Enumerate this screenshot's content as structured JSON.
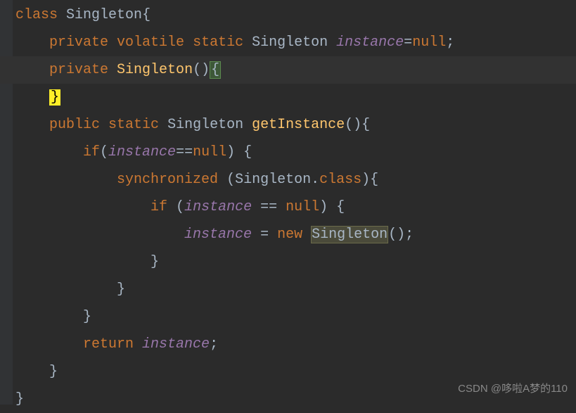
{
  "code": {
    "line1": {
      "kw_class": "class",
      "type": "Singleton",
      "brace": "{"
    },
    "line2": {
      "kw_private": "private",
      "kw_volatile": "volatile",
      "kw_static": "static",
      "type": "Singleton",
      "field": "instance",
      "op": "=",
      "kw_null": "null",
      "semi": ";"
    },
    "line3": {
      "kw_private": "private",
      "ctor": "Singleton",
      "parens": "()",
      "brace": "{"
    },
    "line4": {
      "brace": "}"
    },
    "line5": {
      "kw_public": "public",
      "kw_static": "static",
      "type": "Singleton",
      "method": "getInstance",
      "parens": "()",
      "brace": "{"
    },
    "line6": {
      "kw_if": "if",
      "lparen": "(",
      "field": "instance",
      "op": "==",
      "kw_null": "null",
      "rparen": ")",
      "brace": " {"
    },
    "line7": {
      "kw_sync": "synchronized",
      "lparen": " (",
      "type": "Singleton",
      "dot": ".",
      "kw_class": "class",
      "rparen": ")",
      "brace": "{"
    },
    "line8": {
      "kw_if": "if",
      "lparen": " (",
      "field": "instance",
      "op": " == ",
      "kw_null": "null",
      "rparen": ")",
      "brace": " {"
    },
    "line9": {
      "field": "instance",
      "op": " = ",
      "kw_new": "new",
      "ctor": "Singleton",
      "parens": "()",
      "semi": ";"
    },
    "line10": {
      "brace": "}"
    },
    "line11": {
      "brace": "}"
    },
    "line12": {
      "brace": "}"
    },
    "line13": {
      "kw_return": "return",
      "field": "instance",
      "semi": ";"
    },
    "line14": {
      "brace": "}"
    },
    "line15": {
      "brace": "}"
    }
  },
  "watermark": "CSDN @哆啦A梦的110"
}
